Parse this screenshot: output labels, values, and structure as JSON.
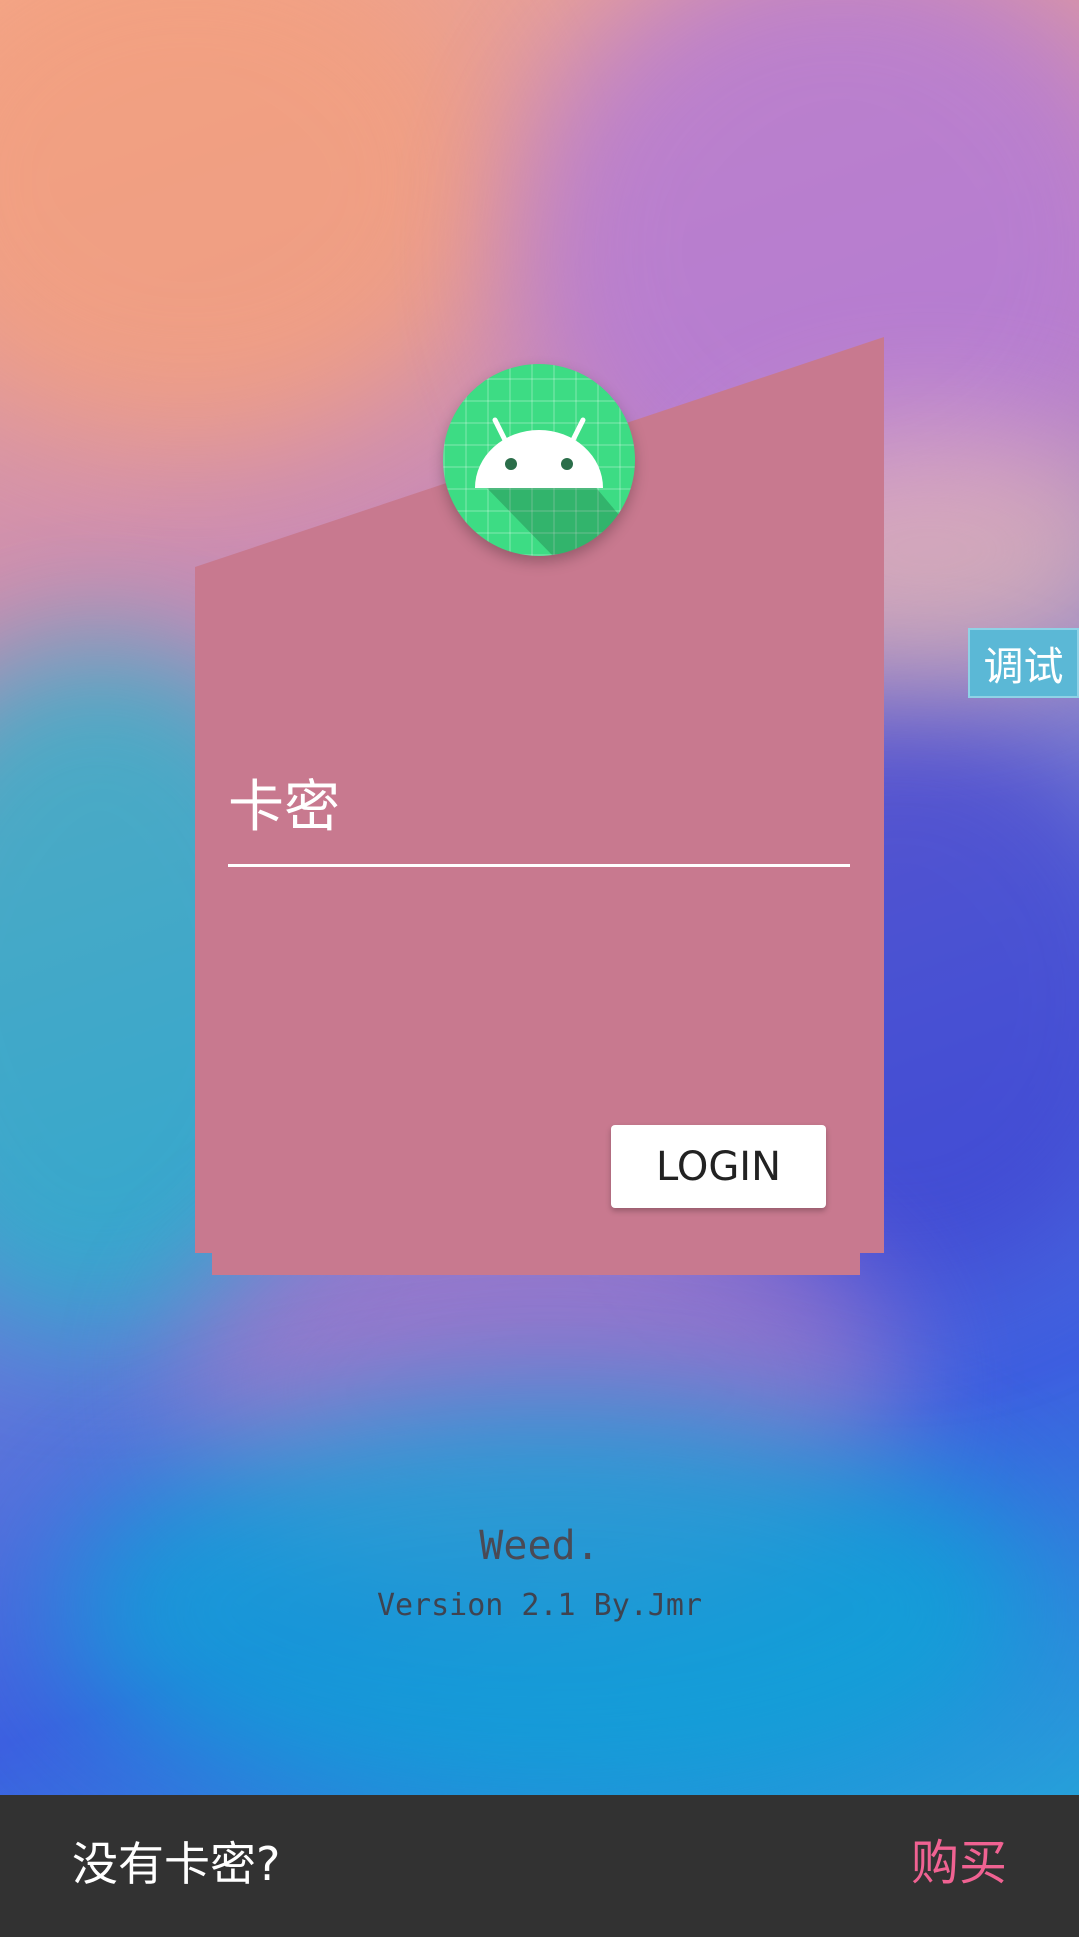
{
  "form": {
    "field_label": "卡密",
    "login_label": "LOGIN"
  },
  "debug": {
    "label": "调试"
  },
  "footer": {
    "app_name": "Weed.",
    "version": "Version 2.1 By.Jmr"
  },
  "snackbar": {
    "message": "没有卡密?",
    "action_label": "购买"
  },
  "colors": {
    "card": "#c8798f",
    "snackbar_bg": "#323232",
    "action": "#f06292",
    "debug_bg": "#5bb8d6",
    "logo_green": "#3ddc84"
  },
  "icons": {
    "logo": "android-robot-icon"
  }
}
